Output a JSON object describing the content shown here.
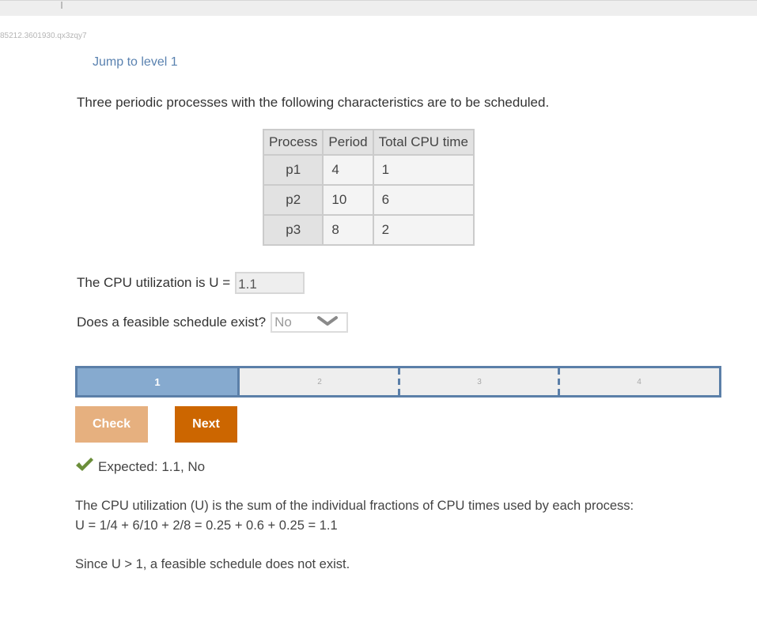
{
  "page": {
    "id_text": "85212.3601930.qx3zqy7",
    "jump_link": "Jump to level 1",
    "intro": "Three periodic processes with the following characteristics are to be scheduled."
  },
  "table": {
    "headers": [
      "Process",
      "Period",
      "Total CPU time"
    ],
    "rows": [
      {
        "process": "p1",
        "period": "4",
        "cpu_time": "1"
      },
      {
        "process": "p2",
        "period": "10",
        "cpu_time": "6"
      },
      {
        "process": "p3",
        "period": "8",
        "cpu_time": "2"
      }
    ]
  },
  "questions": {
    "utilization_label": "The CPU utilization is U =",
    "utilization_value": "1.1",
    "feasible_label": "Does a feasible schedule exist?",
    "feasible_selected": "No"
  },
  "levels": {
    "items": [
      "1",
      "2",
      "3",
      "4"
    ],
    "current": 1
  },
  "buttons": {
    "check": "Check",
    "next": "Next"
  },
  "feedback": {
    "icon": "checkmark-icon",
    "expected": "Expected: 1.1, No"
  },
  "explanation": {
    "line1": "The CPU utilization (U) is the sum of the individual fractions of CPU times used by each process:",
    "line2": "U = 1/4 + 6/10 + 2/8 = 0.25 + 0.6 + 0.25 = 1.1",
    "line3": "Since U > 1, a feasible schedule does not exist."
  },
  "colors": {
    "link": "#5a82b0",
    "level_active": "#86aacf",
    "level_border": "#5b7fa8",
    "check_button": "#e6b07f",
    "next_button": "#cc6600",
    "checkmark": "#6b8e3a"
  }
}
